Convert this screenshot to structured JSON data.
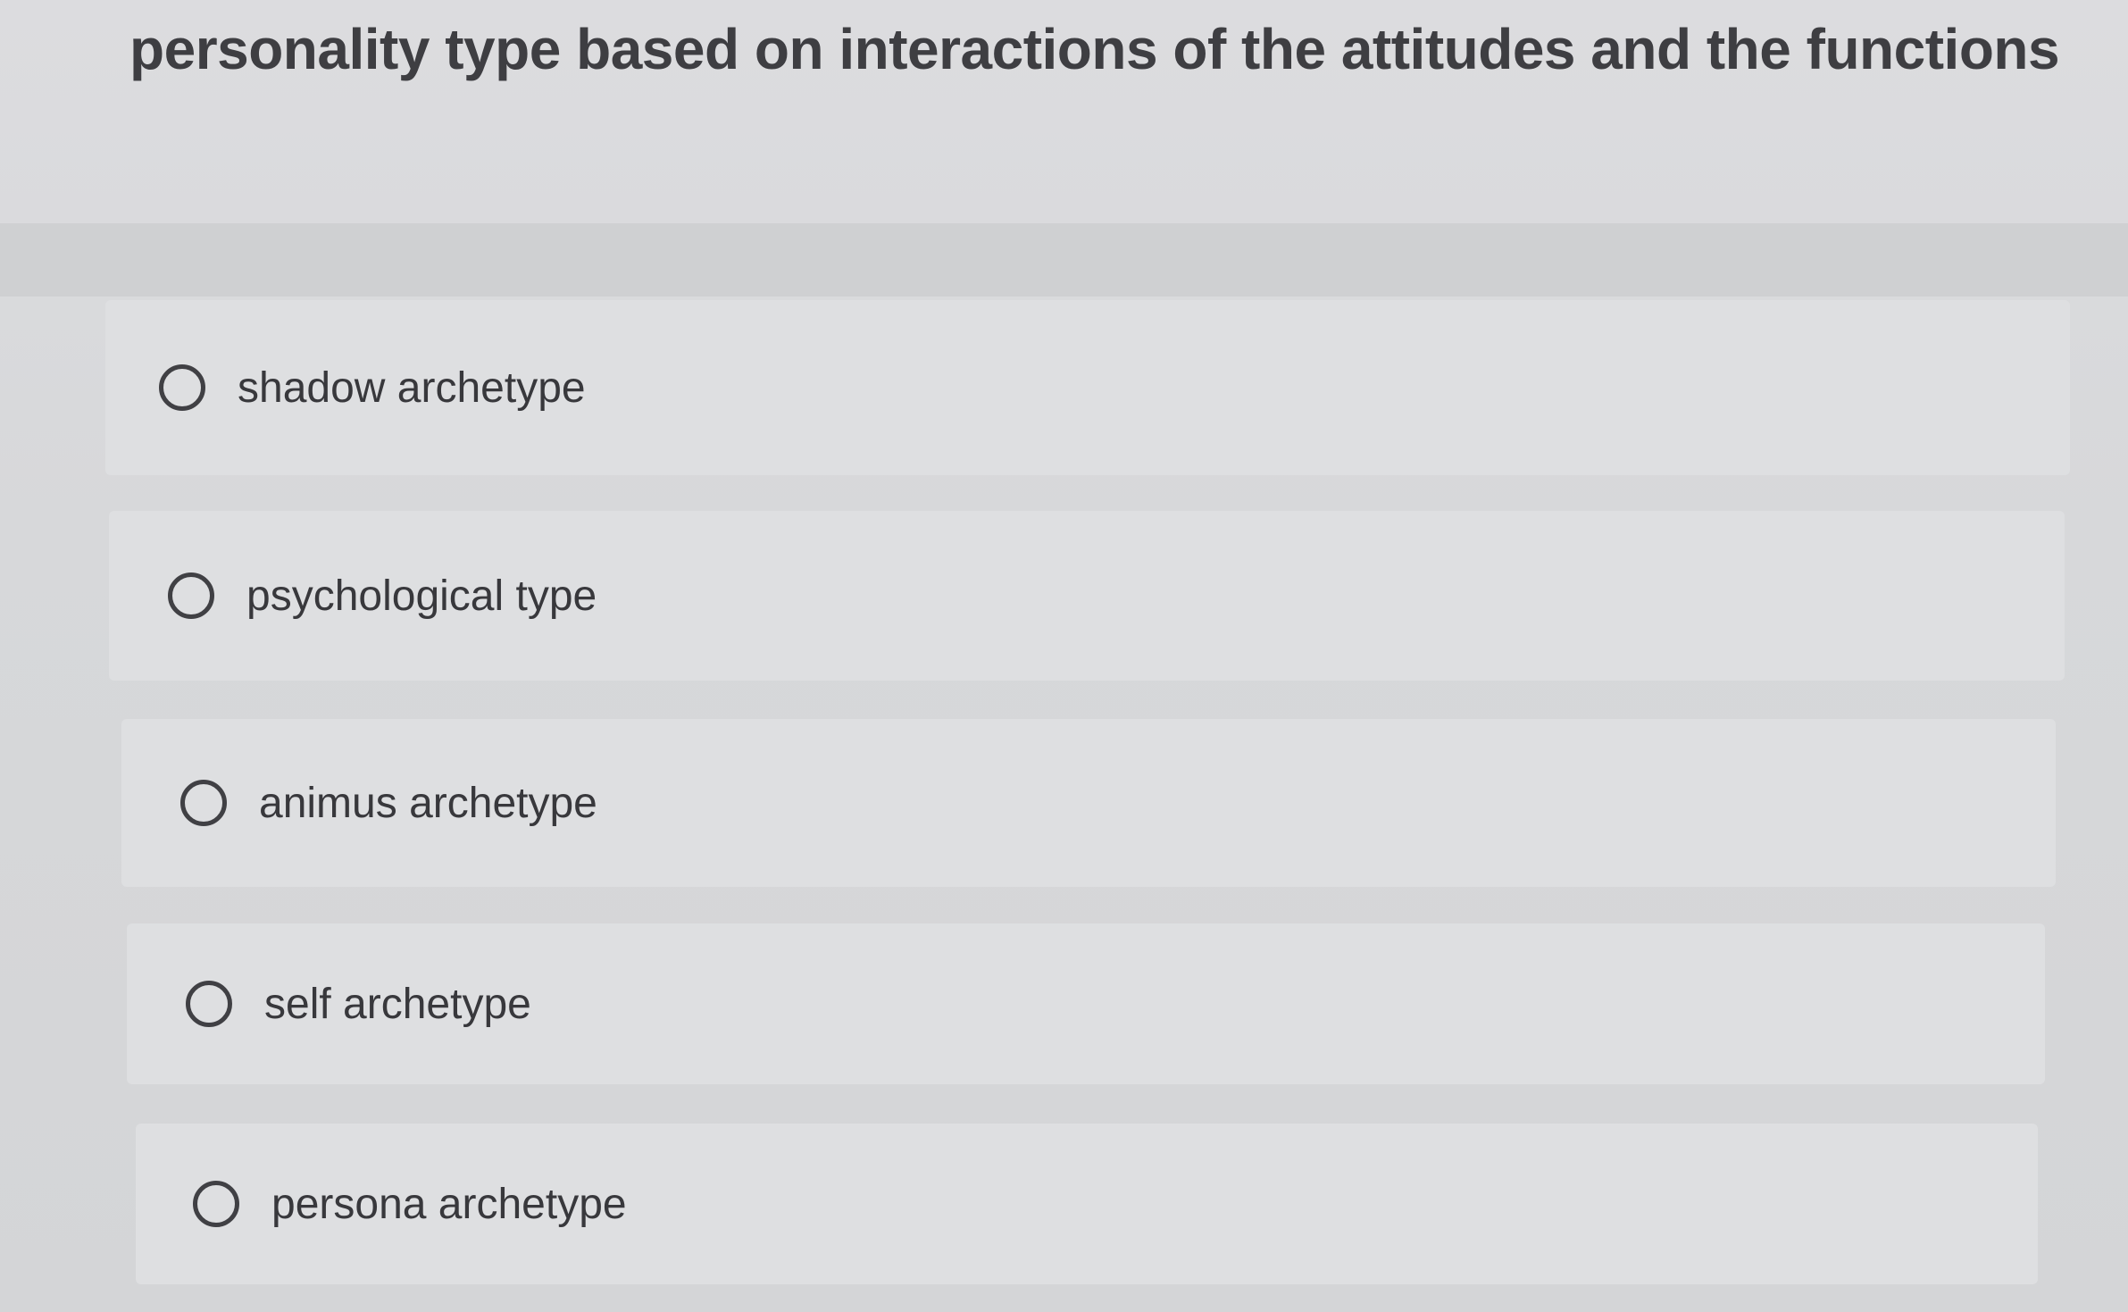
{
  "question": {
    "text": "personality type based on interactions of the attitudes and the functions"
  },
  "options": [
    {
      "label": "shadow archetype",
      "selected": false
    },
    {
      "label": "psychological type",
      "selected": false
    },
    {
      "label": "animus archetype",
      "selected": false
    },
    {
      "label": "self archetype",
      "selected": false
    },
    {
      "label": "persona archetype",
      "selected": false
    }
  ]
}
